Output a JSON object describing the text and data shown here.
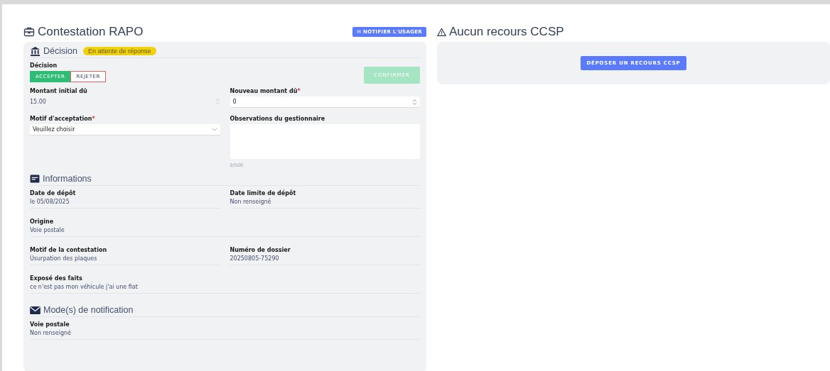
{
  "left": {
    "title": "Contestation RAPO",
    "notify_button": "✉ NOTIFIER L'USAGER",
    "decision_section": {
      "title": "Décision",
      "status_badge": "En attente de réponse"
    },
    "decision": {
      "label": "Décision",
      "options": [
        {
          "label": "ACCEPTER",
          "selected": true
        },
        {
          "label": "REJETER",
          "selected": false
        }
      ],
      "confirm": {
        "label": "CONFIRMER",
        "disabled": true
      }
    },
    "initial_amount": {
      "label": "Montant initial dû",
      "value": "15.00"
    },
    "new_amount": {
      "label": "Nouveau montant dû",
      "required_mark": "*",
      "value": "0"
    },
    "reason": {
      "label": "Motif d'acceptation",
      "required_mark": "*",
      "value": "Veuillez choisir"
    },
    "observations": {
      "label": "Observations du gestionnaire",
      "counter": "0/500"
    },
    "informations": {
      "title": "Informations",
      "rows": [
        {
          "items": [
            {
              "label": "Date de dépôt",
              "value": "le 05/08/2025"
            },
            {
              "label": "Date limite de dépôt",
              "value": "Non renseigné"
            }
          ]
        },
        {
          "items": [
            {
              "label": "Origine",
              "value": "Voie postale"
            }
          ]
        },
        {
          "items": [
            {
              "label": "Motif de la contestation",
              "value": "Usurpation des plaques"
            },
            {
              "label": "Numéro de dossier",
              "value": "20250805-75290"
            }
          ]
        },
        {
          "items": [
            {
              "label": "Exposé des faits",
              "value": "ce n'est pas mon véhicule j'ai une fiat"
            }
          ]
        }
      ]
    },
    "notification": {
      "title": "Mode(s) de notification",
      "rows": [
        {
          "items": [
            {
              "label": "Voie postale",
              "value": "Non renseigné"
            }
          ]
        }
      ]
    }
  },
  "right": {
    "title": "Aucun recours CCSP",
    "button": "DÉPOSER UN RECOURS CCSP"
  }
}
